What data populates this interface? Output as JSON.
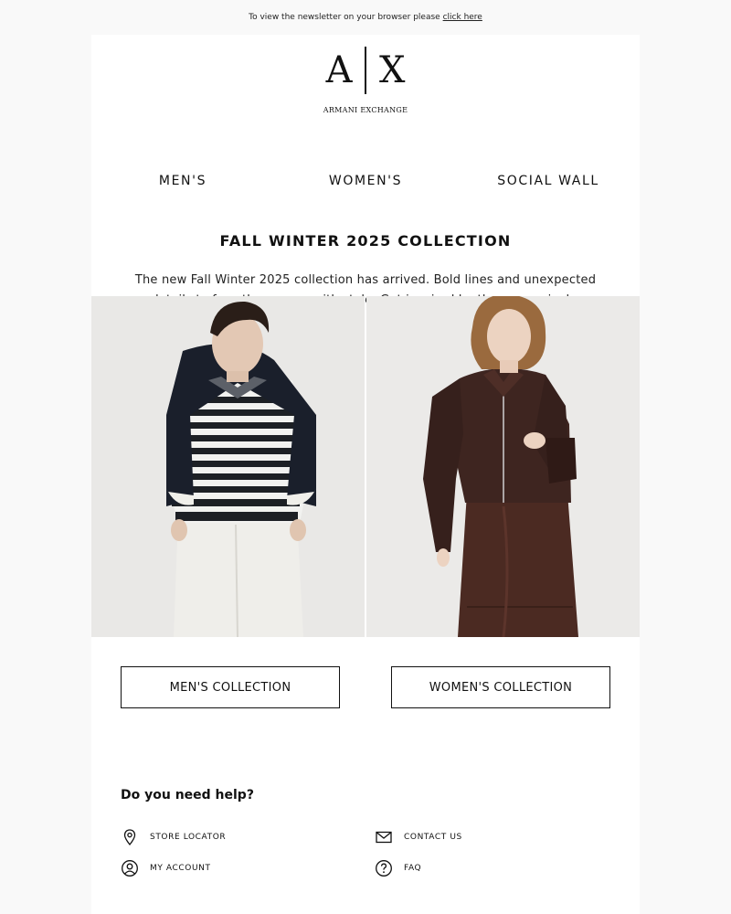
{
  "preheader": {
    "text": "To view the newsletter on your browser please",
    "link": "click here"
  },
  "logo": {
    "left": "A",
    "right": "X",
    "wordmark": "ARMANI EXCHANGE"
  },
  "nav": [
    {
      "label": "MEN'S"
    },
    {
      "label": "WOMEN'S"
    },
    {
      "label": "SOCIAL WALL"
    }
  ],
  "hero": {
    "title": "FALL WINTER 2025 COLLECTION",
    "intro": "The new Fall Winter 2025 collection has arrived. Bold lines and unexpected details to face the season with style. Get inspired by the new arrivals."
  },
  "buttons": {
    "men": "MEN'S COLLECTION",
    "women": "WOMEN'S COLLECTION"
  },
  "help": {
    "title": "Do you need help?",
    "items": [
      {
        "label": "STORE LOCATOR",
        "icon": "location-pin-icon"
      },
      {
        "label": "CONTACT US",
        "icon": "envelope-icon"
      },
      {
        "label": "MY ACCOUNT",
        "icon": "user-circle-icon"
      },
      {
        "label": "FAQ",
        "icon": "question-circle-icon"
      }
    ]
  }
}
